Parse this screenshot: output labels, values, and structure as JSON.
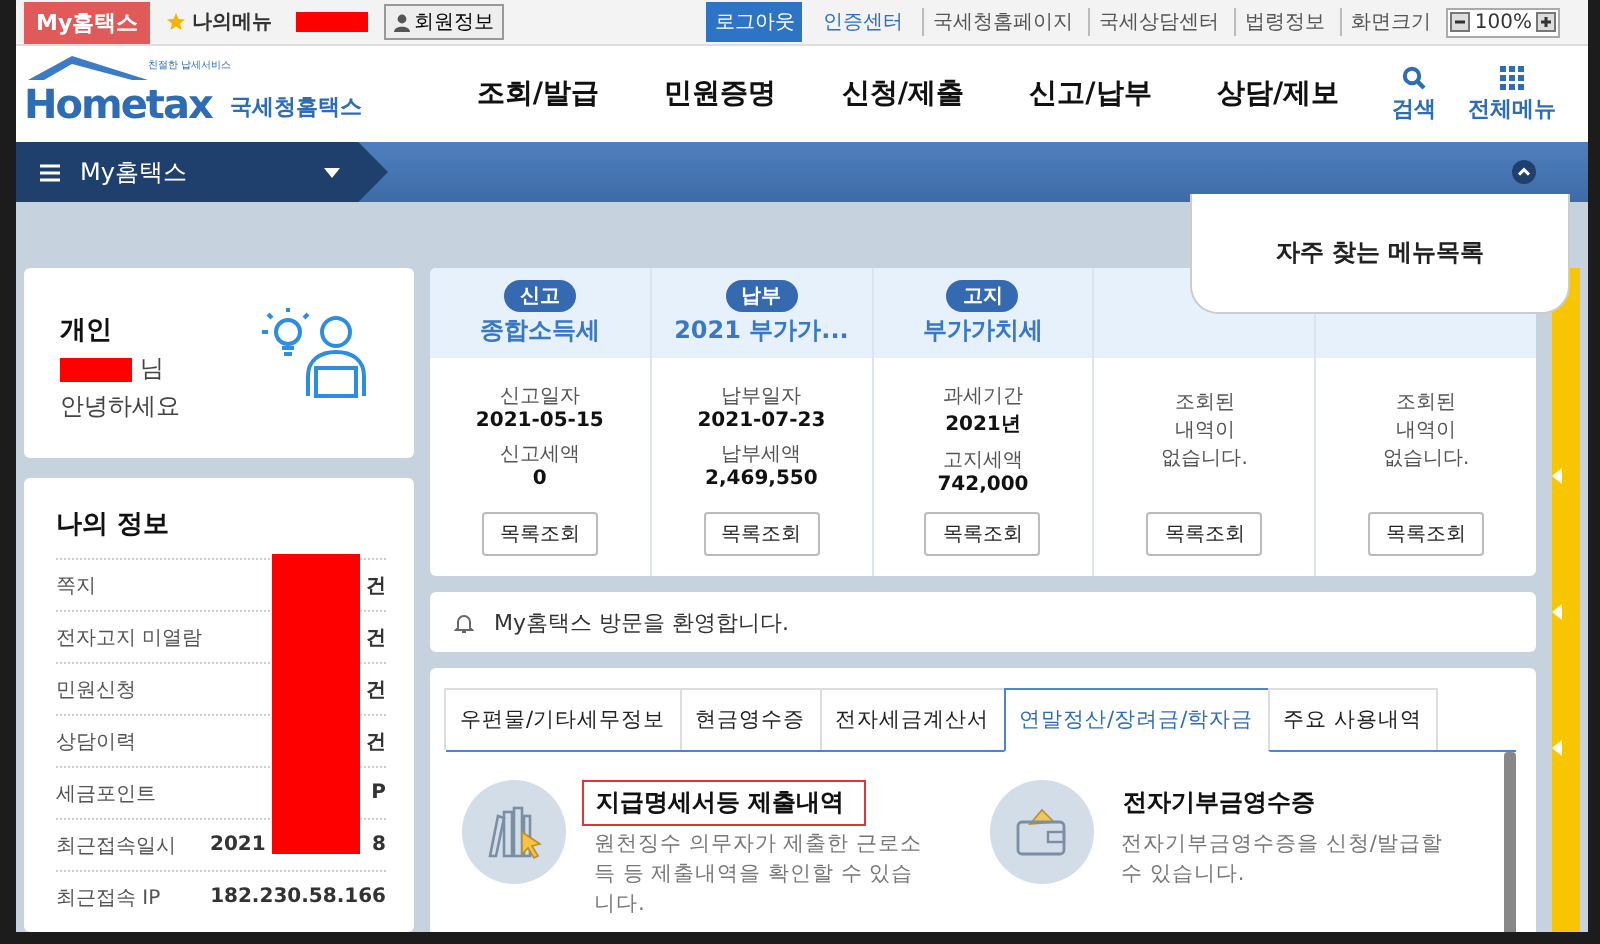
{
  "top_bar": {
    "my_hometax": "My홈택스",
    "my_menu": "나의메뉴",
    "member_name_redacted": true,
    "member_info": "회원정보",
    "logout": "로그아웃",
    "cert_center": "인증센터",
    "links": [
      "국세청홈페이지",
      "국세상담센터",
      "법령정보"
    ],
    "zoom_label": "화면크기",
    "zoom_value": "100%"
  },
  "header": {
    "logo": "Hometax",
    "logo_tagline": "친절한 납세서비스",
    "logo_subtitle": "국세청홈택스",
    "menu": [
      "조회/발급",
      "민원증명",
      "신청/제출",
      "신고/납부",
      "상담/제보"
    ],
    "search": "검색",
    "all_menu": "전체메뉴"
  },
  "nav": {
    "title": "My홈택스"
  },
  "popup": {
    "title": "자주 찾는 메뉴목록"
  },
  "profile": {
    "type": "개인",
    "name_redacted": true,
    "suffix": "님",
    "greeting": "안녕하세요"
  },
  "my_info": {
    "title": "나의 정보",
    "redacted": true,
    "rows": [
      {
        "label": "쪽지",
        "values": [
          "건"
        ]
      },
      {
        "label": "전자고지 미열람",
        "values": [
          "건"
        ]
      },
      {
        "label": "민원신청",
        "values": [
          "건"
        ]
      },
      {
        "label": "상담이력",
        "values": [
          "건"
        ]
      },
      {
        "label": "세금포인트",
        "values": [
          "P"
        ]
      },
      {
        "label": "최근접속일시",
        "values": [
          "2021",
          "8"
        ]
      },
      {
        "label": "최근접속 IP",
        "values": [
          "182.230.58.166"
        ]
      }
    ]
  },
  "tax_cards": [
    {
      "kind": "data",
      "badge": "신고",
      "title": "종합소득세",
      "lines": [
        {
          "label": "신고일자",
          "value": "2021-05-15"
        },
        {
          "label": "신고세액",
          "value": "0"
        }
      ],
      "button": "목록조회"
    },
    {
      "kind": "data",
      "badge": "납부",
      "title": "2021 부가가...",
      "lines": [
        {
          "label": "납부일자",
          "value": "2021-07-23"
        },
        {
          "label": "납부세액",
          "value": "2,469,550"
        }
      ],
      "button": "목록조회"
    },
    {
      "kind": "data",
      "badge": "고지",
      "title": "부가가치세",
      "lines": [
        {
          "label": "과세기간",
          "value": "2021년"
        },
        {
          "label": "고지세액",
          "value": "742,000"
        }
      ],
      "button": "목록조회"
    },
    {
      "kind": "empty",
      "message": "조회된 내역이 없습니다.",
      "button": "목록조회"
    },
    {
      "kind": "empty",
      "message": "조회된 내역이 없습니다.",
      "button": "목록조회"
    }
  ],
  "notice": {
    "text": "My홈택스 방문을 환영합니다."
  },
  "tabs": [
    {
      "label": "우편물/기타세무정보",
      "selected": false
    },
    {
      "label": "현금영수증",
      "selected": false
    },
    {
      "label": "전자세금계산서",
      "selected": false
    },
    {
      "label": "연말정산/장려금/학자금",
      "selected": true
    },
    {
      "label": "주요 사용내역",
      "selected": false
    }
  ],
  "services": [
    {
      "kind": "books",
      "title": "지급명세서등 제출내역",
      "description": "원천징수 의무자가 제출한 근로소득 등 제출내역을 확인할 수 있습니다.",
      "highlighted": true
    },
    {
      "kind": "wallet",
      "title": "전자기부금영수증",
      "description": "전자기부금영수증을 신청/발급할 수 있습니다.",
      "highlighted": false
    }
  ]
}
